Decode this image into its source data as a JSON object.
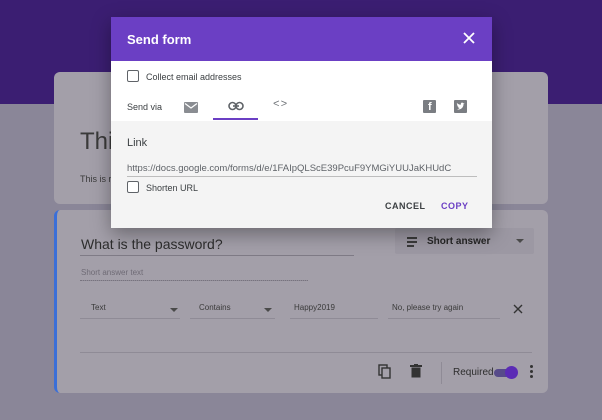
{
  "dialog": {
    "title": "Send form",
    "collect_email_label": "Collect email addresses",
    "send_via_label": "Send via",
    "tabs": [
      {
        "name": "email",
        "icon": "mail-icon",
        "active": false
      },
      {
        "name": "link",
        "icon": "link-icon",
        "active": true
      },
      {
        "name": "embed",
        "icon": "embed-icon",
        "glyph": "<>",
        "active": false
      }
    ],
    "social": [
      {
        "icon": "facebook-icon",
        "glyph": "f"
      },
      {
        "icon": "twitter-icon"
      }
    ],
    "link_label": "Link",
    "link_url": "https://docs.google.com/forms/d/e/1FAIpQLScE39PcuF9YMGiYUUJaKHUdC",
    "shorten_url_label": "Shorten URL",
    "cancel_label": "CANCEL",
    "copy_label": "COPY"
  },
  "background": {
    "form_title": "Thi",
    "form_desc": "This is r",
    "question": {
      "text": "What is the password?",
      "type_label": "Short answer",
      "short_answer_placeholder": "Short answer text",
      "validation": {
        "type": "Text",
        "condition": "Contains",
        "value": "Happy2019",
        "error_text": "No, please try again"
      },
      "required_label": "Required",
      "required": true
    }
  },
  "colors": {
    "header_purple": "#6b3fc4",
    "top_band": "#3b1e72",
    "overlay": "#8a8698"
  }
}
